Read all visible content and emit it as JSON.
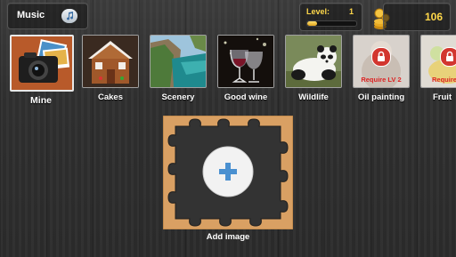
{
  "header": {
    "music_label": "Music",
    "music_icon": "music-note-icon",
    "level_label": "Level:",
    "level_value": "1",
    "level_progress_percent": 20,
    "coin_icon": "coin-stack-icon",
    "coins": "106"
  },
  "categories": [
    {
      "label": "Mine",
      "locked": false,
      "selected": true
    },
    {
      "label": "Cakes",
      "locked": false
    },
    {
      "label": "Scenery",
      "locked": false
    },
    {
      "label": "Good wine",
      "locked": false
    },
    {
      "label": "Wildlife",
      "locked": false
    },
    {
      "label": "Oil painting",
      "locked": true,
      "lock_text": "Require LV 2"
    },
    {
      "label": "Fruit",
      "locked": true,
      "lock_text": "Require"
    }
  ],
  "add_image": {
    "label": "Add image",
    "icon": "plus-icon"
  },
  "colors": {
    "accent_gold": "#ffd84a",
    "lock_red": "#d2362f",
    "puzzle_frame": "#d9a063"
  }
}
